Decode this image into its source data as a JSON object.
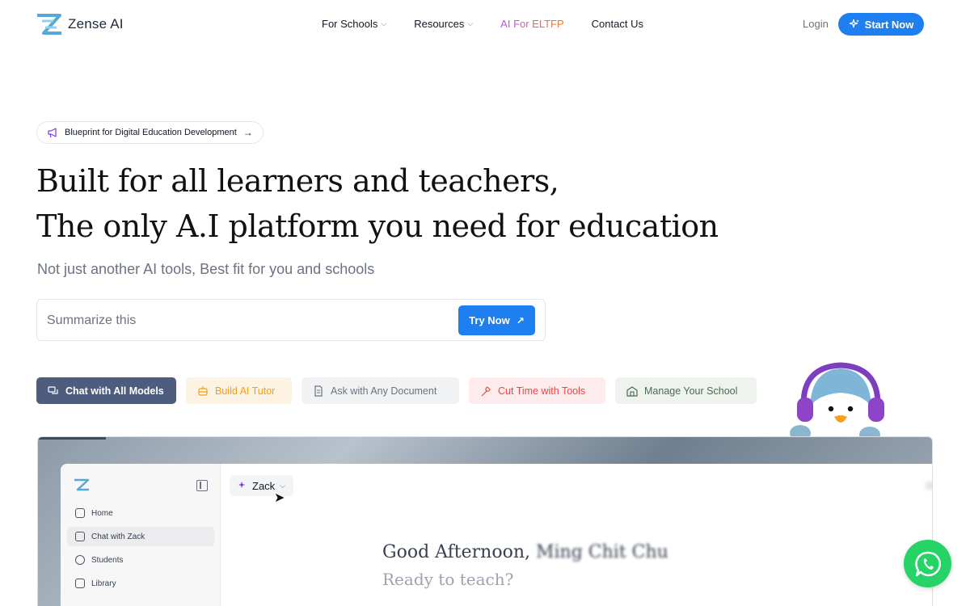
{
  "nav": {
    "brand": "Zense AI",
    "links": [
      {
        "label": "For Schools",
        "has_dropdown": true
      },
      {
        "label": "Resources",
        "has_dropdown": true
      },
      {
        "label": "AI For ELTFP",
        "has_dropdown": false
      },
      {
        "label": "Contact Us",
        "has_dropdown": false
      }
    ],
    "login": "Login",
    "start_now": "Start Now"
  },
  "hero": {
    "badge": "Blueprint for Digital Education Development",
    "headline_line1": "Built for all learners and teachers,",
    "headline_line2": "The only A.I platform you need for education",
    "subtitle": "Not just another AI tools, Best fit for you and schools",
    "search_placeholder": "Summarize this",
    "try_now": "Try Now"
  },
  "feature_tabs": [
    {
      "label": "Chat with All Models",
      "icon": "chat-icon",
      "active": true
    },
    {
      "label": "Build AI Tutor",
      "icon": "bot-icon",
      "active": false
    },
    {
      "label": "Ask with Any Document",
      "icon": "document-icon",
      "active": false
    },
    {
      "label": "Cut Time with Tools",
      "icon": "wrench-icon",
      "active": false
    },
    {
      "label": "Manage Your School",
      "icon": "school-icon",
      "active": false
    }
  ],
  "preview": {
    "sidebar_items": [
      {
        "label": "Home",
        "icon": "home-icon"
      },
      {
        "label": "Chat with Zack",
        "icon": "chat-icon",
        "active": true
      },
      {
        "label": "Students",
        "icon": "users-icon"
      },
      {
        "label": "Library",
        "icon": "library-icon"
      }
    ],
    "model_name": "Zack",
    "greeting_prefix": "Good Afternoon,",
    "greeting_name": "Ming Chit Chu",
    "ready": "Ready to teach?"
  },
  "colors": {
    "accent": "#1d7ff0",
    "active_tab": "#4e5d7e",
    "whatsapp": "#25d366"
  }
}
